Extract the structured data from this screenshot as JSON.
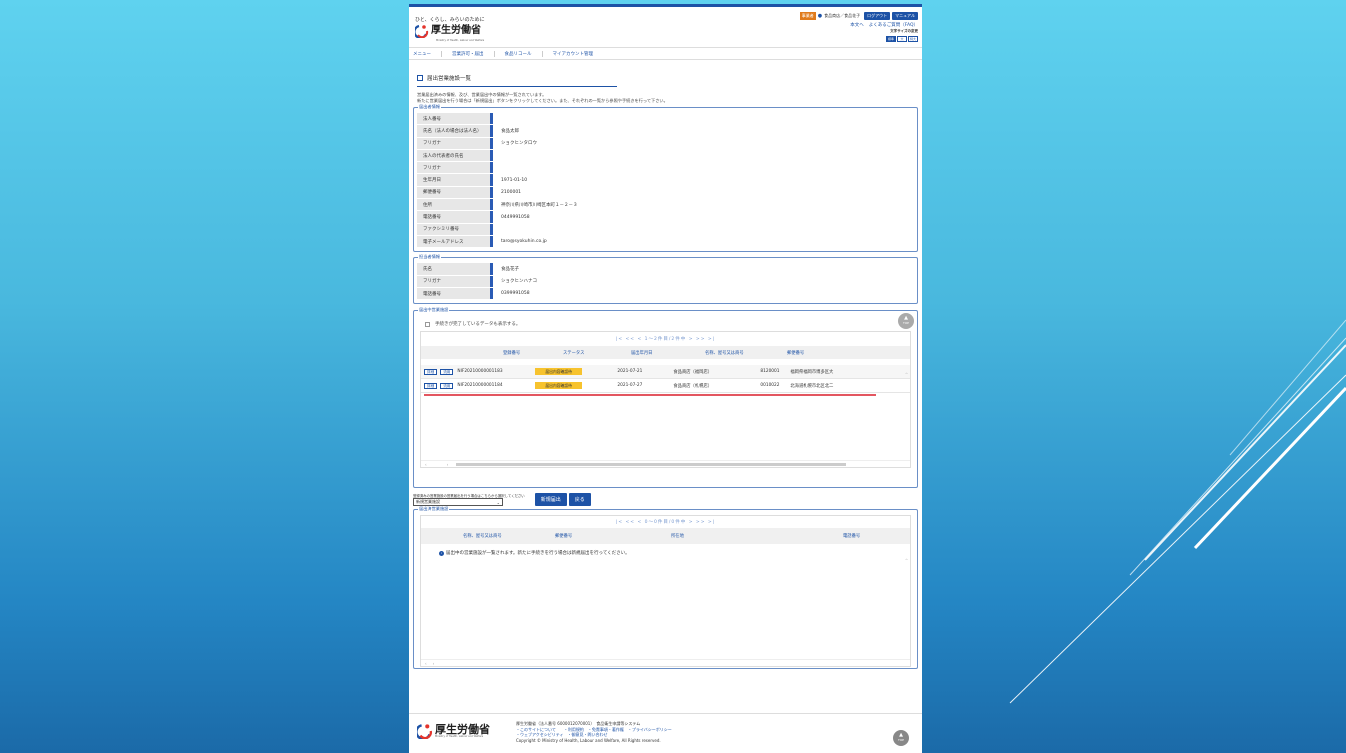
{
  "header": {
    "tagline": "ひと、くらし、みらいのために",
    "logo_text": "厚生労働省",
    "logo_sub": "Ministry of Health, Labour and Welfare",
    "badge": "事業者",
    "user": "食品商店／食品花子",
    "logout": "ログアウト",
    "manual": "マニュアル",
    "links": [
      "本文へ",
      "よくあるご質問（FAQ）"
    ],
    "fontsize_label": "文字サイズの変更",
    "fontsize_btns": [
      "標準",
      "大",
      "特大"
    ]
  },
  "nav": [
    "メニュー",
    "営業許可・届出",
    "食品リコール",
    "マイアカウント管理"
  ],
  "page": {
    "title": "届出営業施設一覧",
    "desc1": "営業届出済みの情報、及び、営業届出中の情報が一覧されています。",
    "desc2": "新たに営業届出を行う場合は「新規届出」ボタンをクリックしてください。また、それぞれの一覧から参照や手続きを行って下さい。"
  },
  "notifier": {
    "legend": "届出者情報",
    "rows": [
      {
        "label": "法人番号",
        "value": ""
      },
      {
        "label": "氏名（法人の場合は法人名）",
        "value": "食品太郎"
      },
      {
        "label": "フリガナ",
        "value": "ショクヒンタロウ"
      },
      {
        "label": "法人の代表者の氏名",
        "value": ""
      },
      {
        "label": "フリガナ",
        "value": ""
      },
      {
        "label": "生年月日",
        "value": "1971-01-10"
      },
      {
        "label": "郵便番号",
        "value": "2100001"
      },
      {
        "label": "住所",
        "value": "神奈川県川崎市川崎区本町１－２－３"
      },
      {
        "label": "電話番号",
        "value": "0449991058"
      },
      {
        "label": "ファクシミリ番号",
        "value": ""
      },
      {
        "label": "電子メールアドレス",
        "value": "taro@syokuhin.co.jp"
      }
    ]
  },
  "contact": {
    "legend": "担当者情報",
    "rows": [
      {
        "label": "氏名",
        "value": "食品花子"
      },
      {
        "label": "フリガナ",
        "value": "ショクヒンハナコ"
      },
      {
        "label": "電話番号",
        "value": "0399991058"
      }
    ]
  },
  "pending": {
    "legend": "届出中営業施設",
    "checkbox_label": "手続きが完了しているデータも表示する。",
    "pager": "|<  <<  <  1～2件目/2件中  >  >>  >|",
    "top_label": "TOP",
    "headers": [
      "登録番号",
      "ステータス",
      "届出年月日",
      "名称、屋号又は商号",
      "郵便番号"
    ],
    "rows": [
      {
        "detail": "詳細",
        "reuse": "流用",
        "id": "NIF20210000001183",
        "status": "届出内容確認待",
        "date": "2021-07-21",
        "name": "食品商店（福岡店）",
        "zip": "8120001",
        "address": "福岡県福岡市博多区大"
      },
      {
        "detail": "詳細",
        "reuse": "流用",
        "id": "NIF20210000001184",
        "status": "届出内容確認待",
        "date": "2021-07-27",
        "name": "食品商店（札幌店）",
        "zip": "0010022",
        "address": "北海道札幌市北区北二"
      }
    ]
  },
  "new_area": {
    "select_label": "登録済みの営業施設の営業届出を行う場合はこちらから選択してください",
    "select_value": "新規営業施設",
    "btn_new": "新規届出",
    "btn_back": "戻る"
  },
  "completed": {
    "legend": "届出済営業施設",
    "pager": "|<  <<  <  0～0件目/0件中  >  >>  >|",
    "headers": [
      "名称、屋号又は商号",
      "郵便番号",
      "所在地",
      "電話番号"
    ],
    "info": "届出中の営業施設が一覧されます。新たに手続きを行う場合は新規届出を行ってください。"
  },
  "footer": {
    "logo_text": "厚生労働省",
    "logo_sub": "Ministry of Health, Labour and Welfare",
    "line1": "厚生労働省（法人番号 6000012070001）　食品衛生申請等システム",
    "line2": "・このサイトについて　　・利用規約　・免責事項・著作権　・プライバシーポリシー",
    "line3": "・ウェブアクセシビリティ　・御意見・問い合わせ",
    "copyright": "Copyright © Ministry of Health, Labour and Welfare, All Rights reserved.",
    "top_label": "TOP"
  }
}
